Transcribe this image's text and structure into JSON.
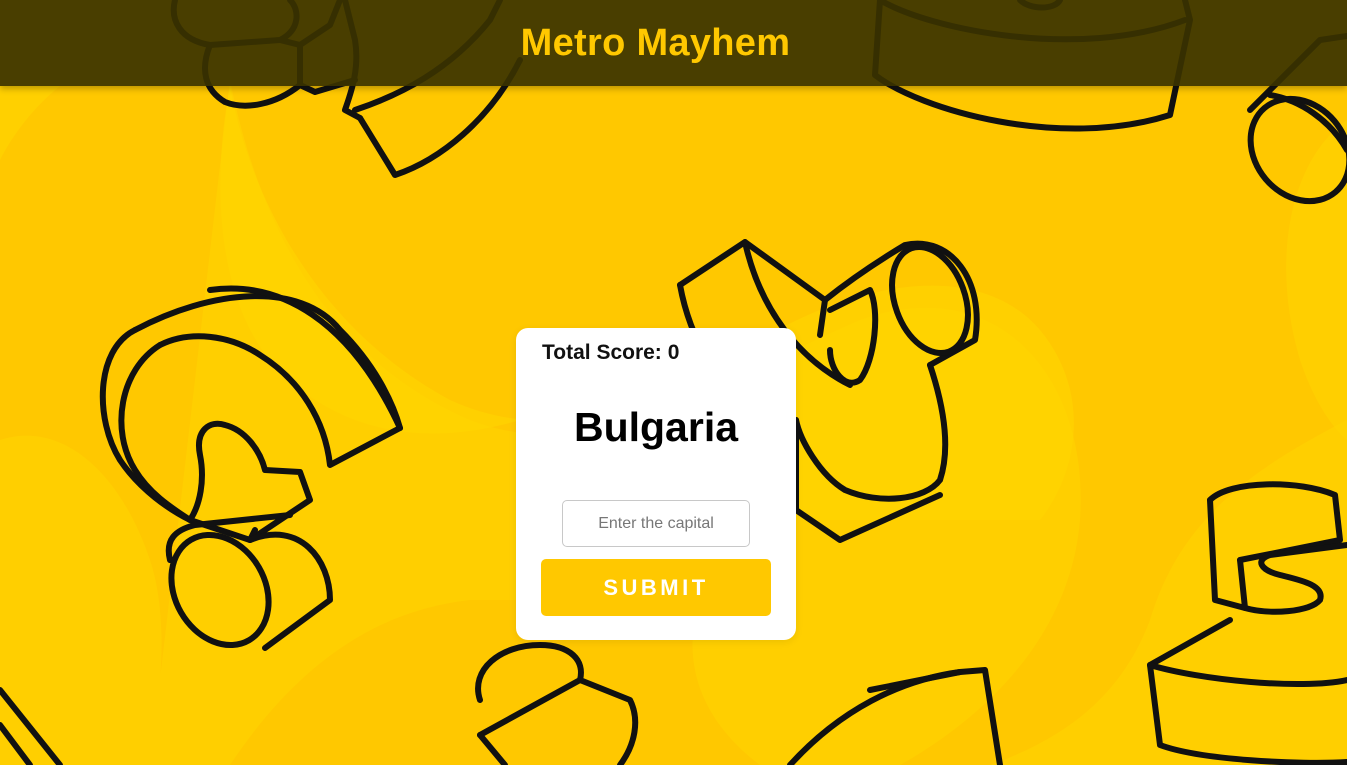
{
  "header": {
    "title": "Metro Mayhem"
  },
  "quiz": {
    "score_label": "Total Score:",
    "score_value": "0",
    "country": "Bulgaria",
    "capital_placeholder": "Enter the capital",
    "capital_value": "",
    "submit_label": "SUBMIT"
  },
  "colors": {
    "background": "#ffc800",
    "background_light": "#ffd600",
    "header_bg": "#3a3200",
    "accent": "#ffc800",
    "card": "#ffffff",
    "outline": "#111111"
  },
  "background_art": {
    "pattern": "3d-question-marks-outline"
  }
}
